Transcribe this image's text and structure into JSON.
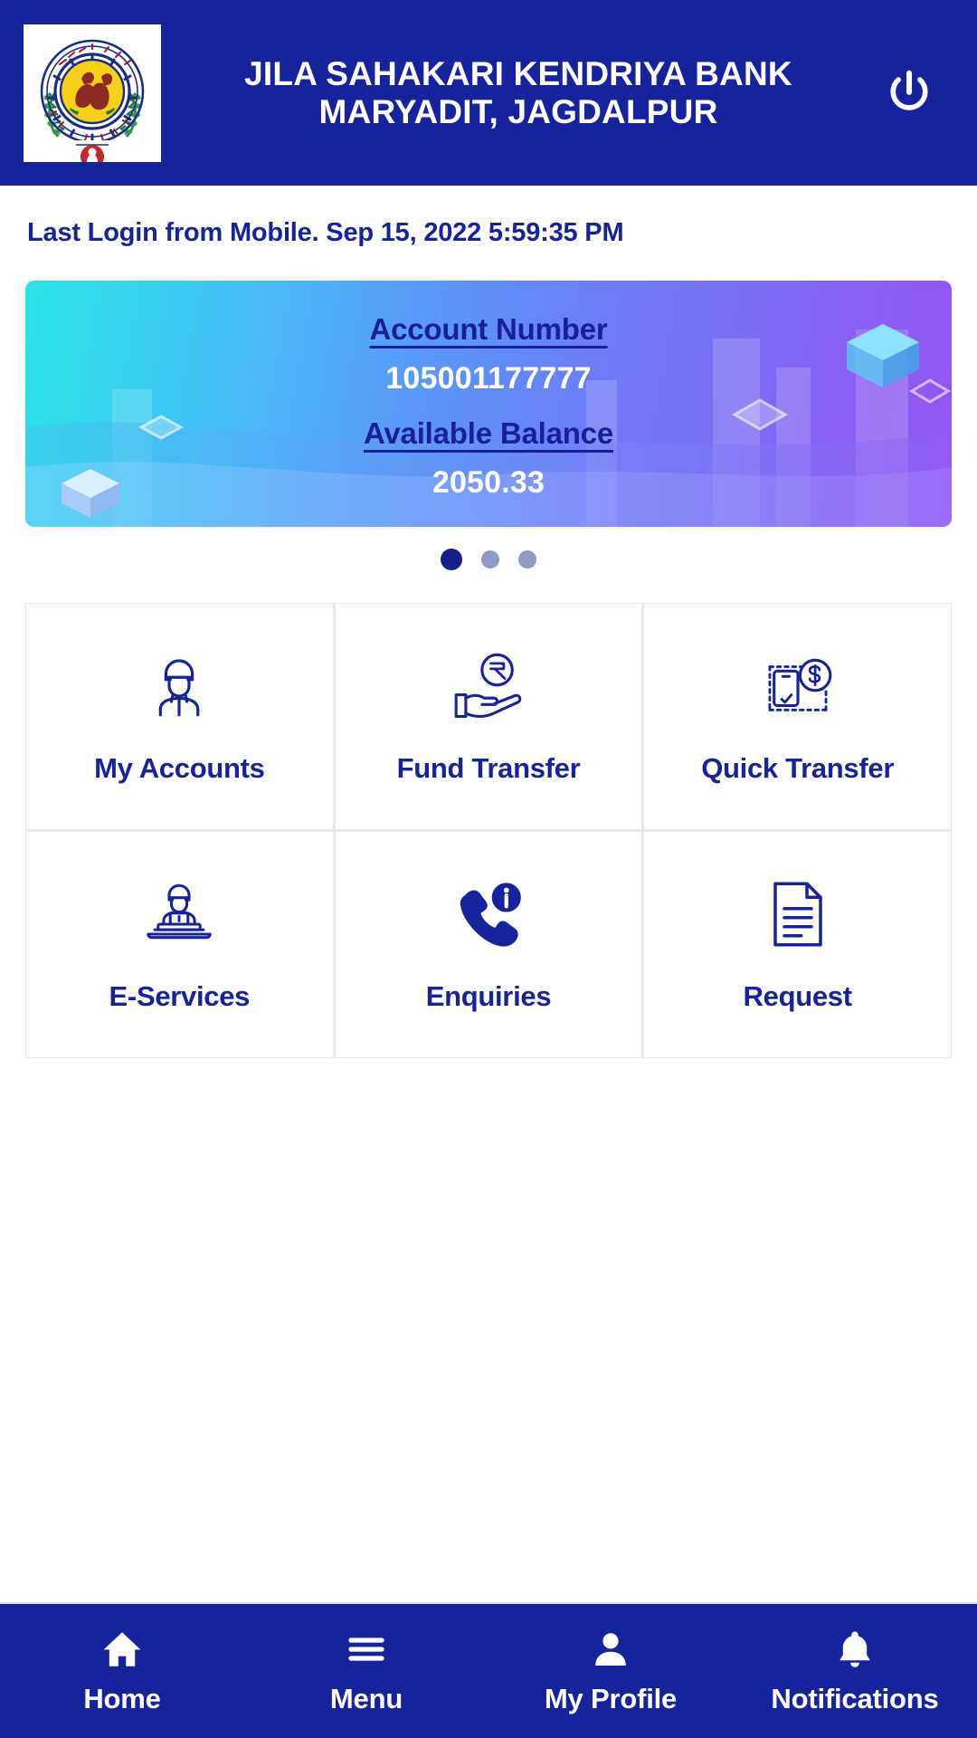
{
  "header": {
    "title_line1": "JILA SAHAKARI KENDRIYA BANK",
    "title_line2": "MARYADIT, JAGDALPUR",
    "logo_alt": "bank-emblem",
    "power_label": "Logout",
    "bg_color": "#15239C"
  },
  "last_login": {
    "text": "Last Login from Mobile. Sep 15, 2022 5:59:35 PM"
  },
  "account_card": {
    "account_number_label": "Account Number",
    "account_number_value": "105001177777",
    "available_balance_label": "Available Balance",
    "available_balance_value": "2050.33",
    "gradient_from": "#2ae4e4",
    "gradient_to": "#9455f3"
  },
  "carousel": {
    "total": 3,
    "active_index": 0,
    "active_color": "#141F8C",
    "inactive_color": "#8E9BC4"
  },
  "tiles": [
    {
      "label": "My Accounts",
      "icon": "user-account-icon"
    },
    {
      "label": "Fund Transfer",
      "icon": "hand-rupee-coin-icon"
    },
    {
      "label": "Quick Transfer",
      "icon": "mobile-dollar-icon"
    },
    {
      "label": "E-Services",
      "icon": "person-laptop-icon"
    },
    {
      "label": "Enquiries",
      "icon": "phone-info-icon"
    },
    {
      "label": "Request",
      "icon": "document-icon"
    }
  ],
  "bottom_nav": [
    {
      "label": "Home",
      "icon": "home-icon",
      "active": true
    },
    {
      "label": "Menu",
      "icon": "hamburger-menu-icon",
      "active": false
    },
    {
      "label": "My Profile",
      "icon": "person-icon",
      "active": false
    },
    {
      "label": "Notifications",
      "icon": "bell-icon",
      "active": false
    }
  ],
  "theme": {
    "primary": "#15239C",
    "tile_border": "#e9e9ec"
  }
}
